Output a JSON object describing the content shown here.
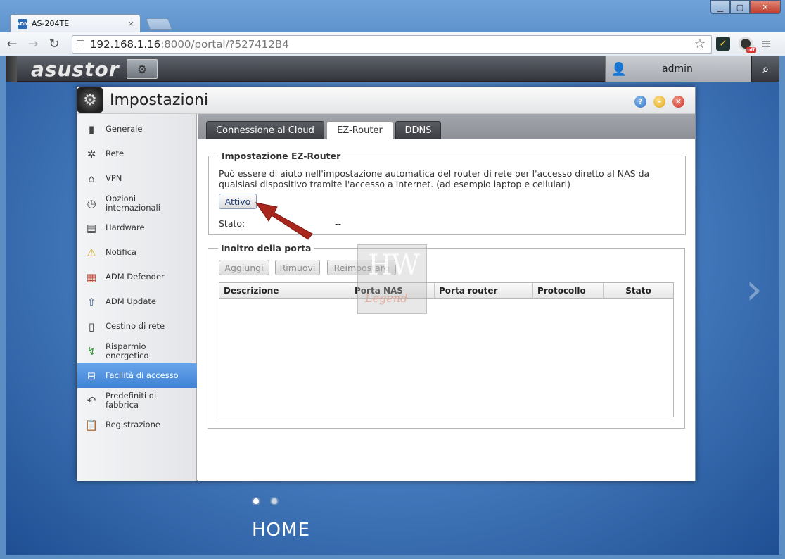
{
  "browser": {
    "tab_title": "AS-204TE",
    "tab_close": "×",
    "favicon_text": "ADM",
    "url_host": "192.168.1.16",
    "url_rest": ":8000/portal/?527412B4",
    "win_min": "▁",
    "win_max": "▢",
    "win_close": "✕"
  },
  "adm_bar": {
    "logo": "asustor",
    "user": "admin"
  },
  "window": {
    "title": "Impostazioni",
    "help": "?",
    "min": "–",
    "close": "✕"
  },
  "sidebar": {
    "items": [
      {
        "label": "Generale",
        "icon": "server-icon",
        "glyph": "▮"
      },
      {
        "label": "Rete",
        "icon": "globe-icon",
        "glyph": "✲"
      },
      {
        "label": "VPN",
        "icon": "house-icon",
        "glyph": "⌂"
      },
      {
        "label": "Opzioni internazionali",
        "icon": "clock-calendar-icon",
        "glyph": "◷"
      },
      {
        "label": "Hardware",
        "icon": "hdd-icon",
        "glyph": "▤"
      },
      {
        "label": "Notifica",
        "icon": "warning-icon",
        "glyph": "⚠"
      },
      {
        "label": "ADM Defender",
        "icon": "firewall-icon",
        "glyph": "▦"
      },
      {
        "label": "ADM Update",
        "icon": "up-arrow-icon",
        "glyph": "⇧"
      },
      {
        "label": "Cestino di rete",
        "icon": "trash-icon",
        "glyph": "▯"
      },
      {
        "label": "Risparmio energetico",
        "icon": "power-bolt-icon",
        "glyph": "↯"
      },
      {
        "label": "Facilità di accesso",
        "icon": "router-icon",
        "glyph": "⊟"
      },
      {
        "label": "Predefiniti di fabbrica",
        "icon": "undo-icon",
        "glyph": "↶"
      },
      {
        "label": "Registrazione",
        "icon": "clipboard-icon",
        "glyph": "📋"
      }
    ],
    "active_index": 10
  },
  "tabs": {
    "cloud": "Connessione al Cloud",
    "ez": "EZ-Router",
    "ddns": "DDNS"
  },
  "ez_router": {
    "legend": "Impostazione EZ-Router",
    "description": "Può essere di aiuto nell'impostazione automatica del router di rete per l'accesso diretto al NAS da qualsiasi dispositivo tramite l'accesso a Internet. (ad esempio laptop e cellulari)",
    "button": "Attivo",
    "status_label": "Stato:",
    "status_value": "--"
  },
  "port_forwarding": {
    "legend": "Inoltro della porta",
    "add": "Aggiungi",
    "remove": "Rimuovi",
    "reset": "Reimpostare",
    "columns": [
      "Descrizione",
      "Porta NAS",
      "Porta router",
      "Protocollo",
      "Stato"
    ]
  },
  "desktop": {
    "home_label": "HOME"
  },
  "watermark": {
    "main": "HW",
    "sub": "Legend"
  }
}
